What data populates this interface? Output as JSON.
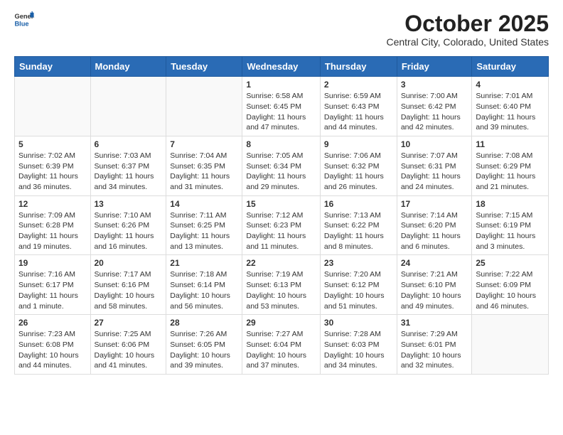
{
  "logo": {
    "general": "General",
    "blue": "Blue"
  },
  "title": "October 2025",
  "subtitle": "Central City, Colorado, United States",
  "headers": [
    "Sunday",
    "Monday",
    "Tuesday",
    "Wednesday",
    "Thursday",
    "Friday",
    "Saturday"
  ],
  "weeks": [
    [
      {
        "day": "",
        "text": "",
        "empty": true
      },
      {
        "day": "",
        "text": "",
        "empty": true
      },
      {
        "day": "",
        "text": "",
        "empty": true
      },
      {
        "day": "1",
        "text": "Sunrise: 6:58 AM\nSunset: 6:45 PM\nDaylight: 11 hours and 47 minutes.",
        "empty": false
      },
      {
        "day": "2",
        "text": "Sunrise: 6:59 AM\nSunset: 6:43 PM\nDaylight: 11 hours and 44 minutes.",
        "empty": false
      },
      {
        "day": "3",
        "text": "Sunrise: 7:00 AM\nSunset: 6:42 PM\nDaylight: 11 hours and 42 minutes.",
        "empty": false
      },
      {
        "day": "4",
        "text": "Sunrise: 7:01 AM\nSunset: 6:40 PM\nDaylight: 11 hours and 39 minutes.",
        "empty": false
      }
    ],
    [
      {
        "day": "5",
        "text": "Sunrise: 7:02 AM\nSunset: 6:39 PM\nDaylight: 11 hours and 36 minutes.",
        "empty": false
      },
      {
        "day": "6",
        "text": "Sunrise: 7:03 AM\nSunset: 6:37 PM\nDaylight: 11 hours and 34 minutes.",
        "empty": false
      },
      {
        "day": "7",
        "text": "Sunrise: 7:04 AM\nSunset: 6:35 PM\nDaylight: 11 hours and 31 minutes.",
        "empty": false
      },
      {
        "day": "8",
        "text": "Sunrise: 7:05 AM\nSunset: 6:34 PM\nDaylight: 11 hours and 29 minutes.",
        "empty": false
      },
      {
        "day": "9",
        "text": "Sunrise: 7:06 AM\nSunset: 6:32 PM\nDaylight: 11 hours and 26 minutes.",
        "empty": false
      },
      {
        "day": "10",
        "text": "Sunrise: 7:07 AM\nSunset: 6:31 PM\nDaylight: 11 hours and 24 minutes.",
        "empty": false
      },
      {
        "day": "11",
        "text": "Sunrise: 7:08 AM\nSunset: 6:29 PM\nDaylight: 11 hours and 21 minutes.",
        "empty": false
      }
    ],
    [
      {
        "day": "12",
        "text": "Sunrise: 7:09 AM\nSunset: 6:28 PM\nDaylight: 11 hours and 19 minutes.",
        "empty": false
      },
      {
        "day": "13",
        "text": "Sunrise: 7:10 AM\nSunset: 6:26 PM\nDaylight: 11 hours and 16 minutes.",
        "empty": false
      },
      {
        "day": "14",
        "text": "Sunrise: 7:11 AM\nSunset: 6:25 PM\nDaylight: 11 hours and 13 minutes.",
        "empty": false
      },
      {
        "day": "15",
        "text": "Sunrise: 7:12 AM\nSunset: 6:23 PM\nDaylight: 11 hours and 11 minutes.",
        "empty": false
      },
      {
        "day": "16",
        "text": "Sunrise: 7:13 AM\nSunset: 6:22 PM\nDaylight: 11 hours and 8 minutes.",
        "empty": false
      },
      {
        "day": "17",
        "text": "Sunrise: 7:14 AM\nSunset: 6:20 PM\nDaylight: 11 hours and 6 minutes.",
        "empty": false
      },
      {
        "day": "18",
        "text": "Sunrise: 7:15 AM\nSunset: 6:19 PM\nDaylight: 11 hours and 3 minutes.",
        "empty": false
      }
    ],
    [
      {
        "day": "19",
        "text": "Sunrise: 7:16 AM\nSunset: 6:17 PM\nDaylight: 11 hours and 1 minute.",
        "empty": false
      },
      {
        "day": "20",
        "text": "Sunrise: 7:17 AM\nSunset: 6:16 PM\nDaylight: 10 hours and 58 minutes.",
        "empty": false
      },
      {
        "day": "21",
        "text": "Sunrise: 7:18 AM\nSunset: 6:14 PM\nDaylight: 10 hours and 56 minutes.",
        "empty": false
      },
      {
        "day": "22",
        "text": "Sunrise: 7:19 AM\nSunset: 6:13 PM\nDaylight: 10 hours and 53 minutes.",
        "empty": false
      },
      {
        "day": "23",
        "text": "Sunrise: 7:20 AM\nSunset: 6:12 PM\nDaylight: 10 hours and 51 minutes.",
        "empty": false
      },
      {
        "day": "24",
        "text": "Sunrise: 7:21 AM\nSunset: 6:10 PM\nDaylight: 10 hours and 49 minutes.",
        "empty": false
      },
      {
        "day": "25",
        "text": "Sunrise: 7:22 AM\nSunset: 6:09 PM\nDaylight: 10 hours and 46 minutes.",
        "empty": false
      }
    ],
    [
      {
        "day": "26",
        "text": "Sunrise: 7:23 AM\nSunset: 6:08 PM\nDaylight: 10 hours and 44 minutes.",
        "empty": false
      },
      {
        "day": "27",
        "text": "Sunrise: 7:25 AM\nSunset: 6:06 PM\nDaylight: 10 hours and 41 minutes.",
        "empty": false
      },
      {
        "day": "28",
        "text": "Sunrise: 7:26 AM\nSunset: 6:05 PM\nDaylight: 10 hours and 39 minutes.",
        "empty": false
      },
      {
        "day": "29",
        "text": "Sunrise: 7:27 AM\nSunset: 6:04 PM\nDaylight: 10 hours and 37 minutes.",
        "empty": false
      },
      {
        "day": "30",
        "text": "Sunrise: 7:28 AM\nSunset: 6:03 PM\nDaylight: 10 hours and 34 minutes.",
        "empty": false
      },
      {
        "day": "31",
        "text": "Sunrise: 7:29 AM\nSunset: 6:01 PM\nDaylight: 10 hours and 32 minutes.",
        "empty": false
      },
      {
        "day": "",
        "text": "",
        "empty": true
      }
    ]
  ]
}
